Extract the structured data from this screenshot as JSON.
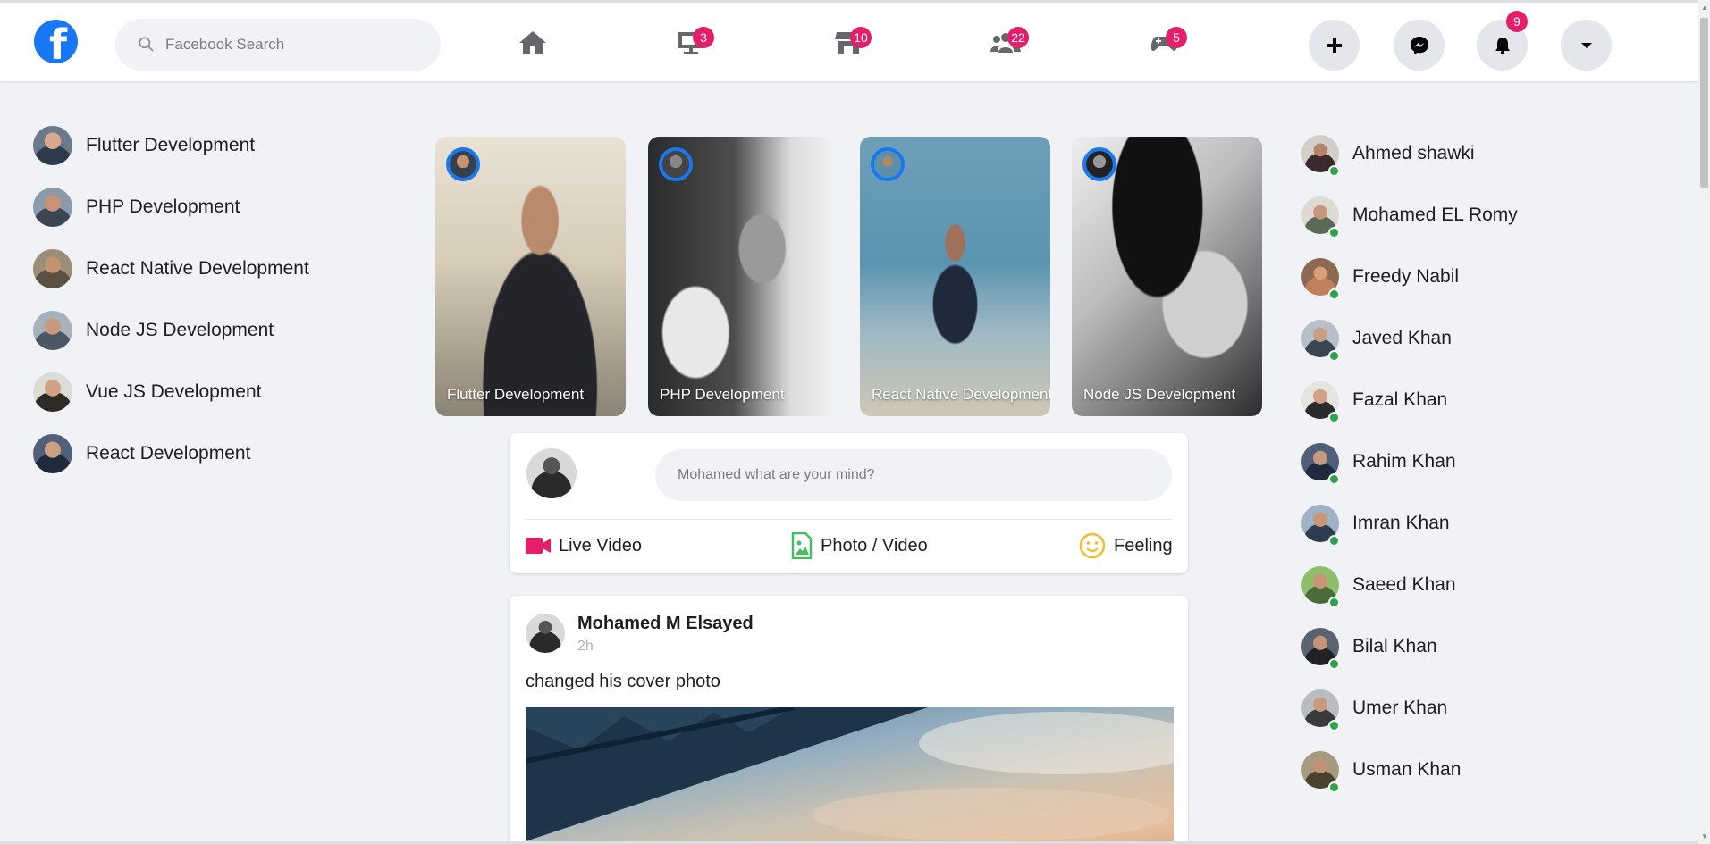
{
  "app": {
    "logo_letter": "f",
    "brand_color": "#1877f2",
    "badge_color": "#e41e6a"
  },
  "search": {
    "placeholder": "Facebook Search"
  },
  "nav": {
    "tabs": [
      {
        "icon": "home-icon",
        "badge": ""
      },
      {
        "icon": "watch-icon",
        "badge": "3"
      },
      {
        "icon": "marketplace-icon",
        "badge": "10"
      },
      {
        "icon": "groups-icon",
        "badge": "22"
      },
      {
        "icon": "gaming-icon",
        "badge": "5"
      }
    ],
    "actions": [
      {
        "icon": "plus-icon",
        "badge": ""
      },
      {
        "icon": "messenger-icon",
        "badge": ""
      },
      {
        "icon": "bell-icon",
        "badge": "9"
      },
      {
        "icon": "caret-down-icon",
        "badge": ""
      }
    ]
  },
  "sidebar": {
    "items": [
      {
        "label": "Flutter Development"
      },
      {
        "label": "PHP Development"
      },
      {
        "label": "React Native Development"
      },
      {
        "label": "Node JS Development"
      },
      {
        "label": "Vue JS Development"
      },
      {
        "label": "React Development"
      }
    ]
  },
  "stories": [
    {
      "title": "Flutter Development"
    },
    {
      "title": "PHP Development"
    },
    {
      "title": "React Native Development"
    },
    {
      "title": "Node JS Development"
    }
  ],
  "composer": {
    "placeholder": "Mohamed what are your mind?",
    "actions": [
      {
        "label": "Live Video",
        "color": "#e41e6a"
      },
      {
        "label": "Photo / Video",
        "color": "#45bd62"
      },
      {
        "label": "Feeling",
        "color": "#f7b928"
      }
    ]
  },
  "post": {
    "author": "Mohamed M Elsayed",
    "time": "2h",
    "text": "changed his cover photo"
  },
  "contacts": [
    {
      "name": "Ahmed shawki"
    },
    {
      "name": "Mohamed EL Romy"
    },
    {
      "name": "Freedy Nabil"
    },
    {
      "name": "Javed Khan"
    },
    {
      "name": "Fazal Khan"
    },
    {
      "name": "Rahim Khan"
    },
    {
      "name": "Imran Khan"
    },
    {
      "name": "Saeed Khan"
    },
    {
      "name": "Bilal Khan"
    },
    {
      "name": "Umer Khan"
    },
    {
      "name": "Usman Khan"
    }
  ]
}
